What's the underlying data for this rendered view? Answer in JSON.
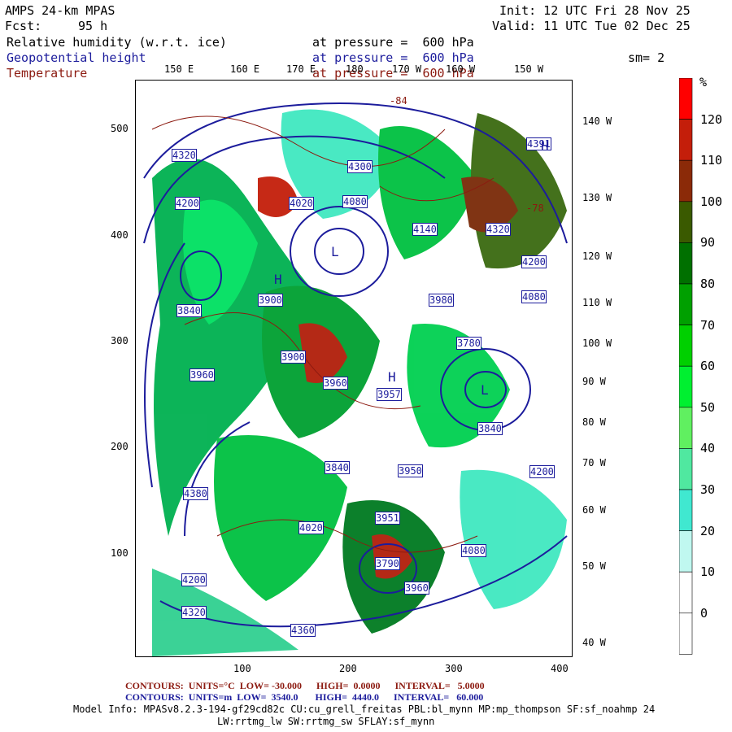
{
  "header": {
    "model": "AMPS 24-km MPAS",
    "fcst_label": "Fcst:",
    "fcst_value": "95 h",
    "init": "Init: 12 UTC Fri 28 Nov 25",
    "valid": "Valid: 11 UTC Tue 02 Dec 25",
    "fields": [
      {
        "name": "Relative humidity (w.r.t. ice)",
        "level": "at pressure =  600 hPa",
        "color": "#000000"
      },
      {
        "name": "Geopotential height",
        "level": "at pressure =  600 hPa",
        "color": "#1c1c9c"
      },
      {
        "name": "Temperature",
        "level": "at pressure =  600 hPa",
        "color": "#8c1a10"
      }
    ],
    "smoothing": "sm= 2"
  },
  "map": {
    "top_lon_labels": [
      "150 E",
      "160 E",
      "170 E",
      "180",
      "170 W",
      "160 W",
      "150 W"
    ],
    "right_lon_labels": [
      "140 W",
      "130 W",
      "120 W",
      "110 W",
      "100 W",
      "90 W",
      "80 W",
      "70 W",
      "60 W",
      "50 W",
      "40 W"
    ],
    "y_ticks": [
      "500",
      "400",
      "300",
      "200",
      "100"
    ],
    "x_ticks": [
      "100",
      "200",
      "300",
      "400"
    ],
    "height_labels": [
      "4320",
      "4300",
      "4020",
      "4080",
      "4140",
      "4320",
      "4200",
      "3960",
      "3900",
      "4391",
      "4200",
      "4080",
      "3980",
      "3840",
      "3900",
      "3780",
      "3957",
      "3960",
      "3840",
      "4200",
      "4380",
      "3840",
      "3950",
      "3951",
      "4020",
      "4080",
      "3790",
      "3960",
      "4200",
      "4320",
      "4360"
    ],
    "high_low_labels": [
      "H",
      "H",
      "H",
      "L",
      "L"
    ],
    "temp_labels": [
      "-84",
      "-78"
    ]
  },
  "colorbar": {
    "unit": "%",
    "labels": [
      "120",
      "110",
      "100",
      "90",
      "80",
      "70",
      "60",
      "50",
      "40",
      "30",
      "20",
      "10",
      "0"
    ],
    "colors": [
      "#ff0000",
      "#c41e0a",
      "#8b2a08",
      "#3a5a00",
      "#007000",
      "#00a000",
      "#00d000",
      "#00f030",
      "#60f060",
      "#50e8a0",
      "#40e8d0",
      "#c0f8f0",
      "#ffffff",
      "#ffffff"
    ]
  },
  "footer": {
    "temp_contours": "CONTOURS:  UNITS=°C  LOW= -30.000      HIGH=  0.0000      INTERVAL=   5.0000",
    "height_contours": "CONTOURS:  UNITS=m  LOW=  3540.0       HIGH=  4440.0      INTERVAL=   60.000",
    "model_info": "Model Info: MPASv8.2.3-194-gf29cd82c CU:cu_grell_freitas PBL:bl_mynn MP:mp_thompson SF:sf_noahmp 24",
    "model_info_2": "LW:rrtmg_lw SW:rrtmg_sw SFLAY:sf_mynn",
    "temp_color": "#8c1a10",
    "height_color": "#1c1c9c"
  }
}
